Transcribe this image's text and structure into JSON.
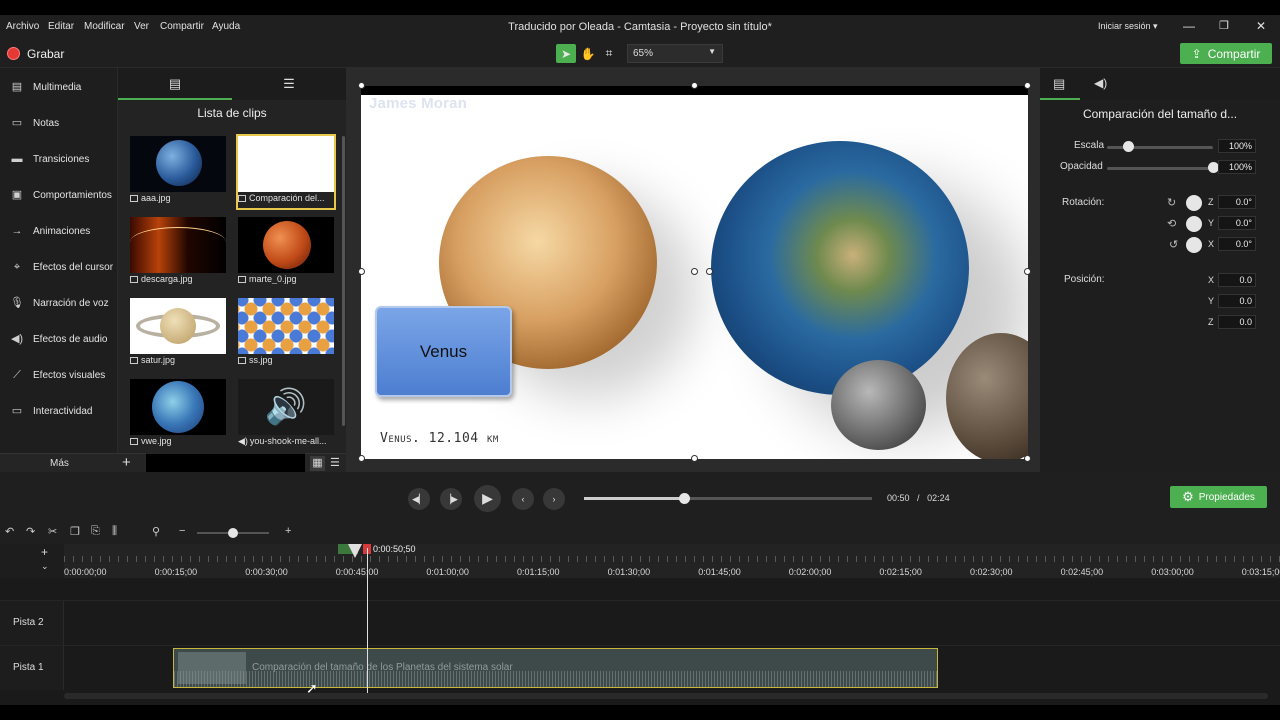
{
  "menu": {
    "items": [
      "Archivo",
      "Editar",
      "Modificar",
      "Ver",
      "Compartir",
      "Ayuda"
    ],
    "title": "Traducido por Oleada - Camtasia - Proyecto sin título*",
    "signin": "Iniciar sesión ▾"
  },
  "toolbar": {
    "record_label": "Grabar",
    "zoom_value": "65%",
    "share_label": "Compartir"
  },
  "sidebar": {
    "items": [
      {
        "label": "Multimedia",
        "icon": "film-icon"
      },
      {
        "label": "Notas",
        "icon": "note-icon"
      },
      {
        "label": "Transiciones",
        "icon": "transition-icon"
      },
      {
        "label": "Comportamientos",
        "icon": "behavior-icon"
      },
      {
        "label": "Animaciones",
        "icon": "animation-icon"
      },
      {
        "label": "Efectos del cursor",
        "icon": "cursor-icon"
      },
      {
        "label": "Narración de voz",
        "icon": "microphone-icon"
      },
      {
        "label": "Efectos de audio",
        "icon": "speaker-icon"
      },
      {
        "label": "Efectos visuales",
        "icon": "wand-icon"
      },
      {
        "label": "Interactividad",
        "icon": "interactivity-icon"
      }
    ],
    "more_label": "Más"
  },
  "clips": {
    "title": "Lista de clips",
    "items": [
      {
        "label": "aaa.jpg"
      },
      {
        "label": "Comparación del..."
      },
      {
        "label": "descarga.jpg"
      },
      {
        "label": "marte_0.jpg"
      },
      {
        "label": "satur.jpg"
      },
      {
        "label": "ss.jpg"
      },
      {
        "label": "vwe.jpg"
      },
      {
        "label": "you-shook-me-all..."
      }
    ]
  },
  "canvas": {
    "watermark": "James Moran",
    "box_label": "Venus",
    "caption": "Venus. 12.104 km"
  },
  "properties": {
    "title": "Comparación del tamaño d...",
    "scale_label": "Escala",
    "scale_value": "100%",
    "scale_level": 0.2,
    "opacity_label": "Opacidad",
    "opacity_value": "100%",
    "opacity_level": 1.0,
    "rotation_label": "Rotación:",
    "rotation": {
      "z": "0.0°",
      "y": "0.0°",
      "x": "0.0°"
    },
    "position_label": "Posición:",
    "position": {
      "x": "0.0",
      "y": "0.0",
      "z": "0.0"
    }
  },
  "playback": {
    "current": "00:50",
    "separator": "/",
    "total": "02:24",
    "progress": 0.347,
    "properties_label": "Propiedades"
  },
  "timeline": {
    "playhead_time": "0:00:50;50",
    "ticks": [
      "0:00:00;00",
      "0:00:15;00",
      "0:00:30;00",
      "0:00:45;00",
      "0:01:00;00",
      "0:01:15;00",
      "0:01:30;00",
      "0:01:45;00",
      "0:02:00;00",
      "0:02:15;00",
      "0:02:30;00",
      "0:02:45;00",
      "0:03:00;00",
      "0:03:15;00"
    ],
    "tracks": [
      "Pista 2",
      "Pista 1"
    ],
    "clip_title": "Comparación del tamaño de los Planetas del sistema solar"
  },
  "colors": {
    "accent": "#4caf50",
    "record": "#e53935",
    "clip_border": "#c8b83a"
  }
}
